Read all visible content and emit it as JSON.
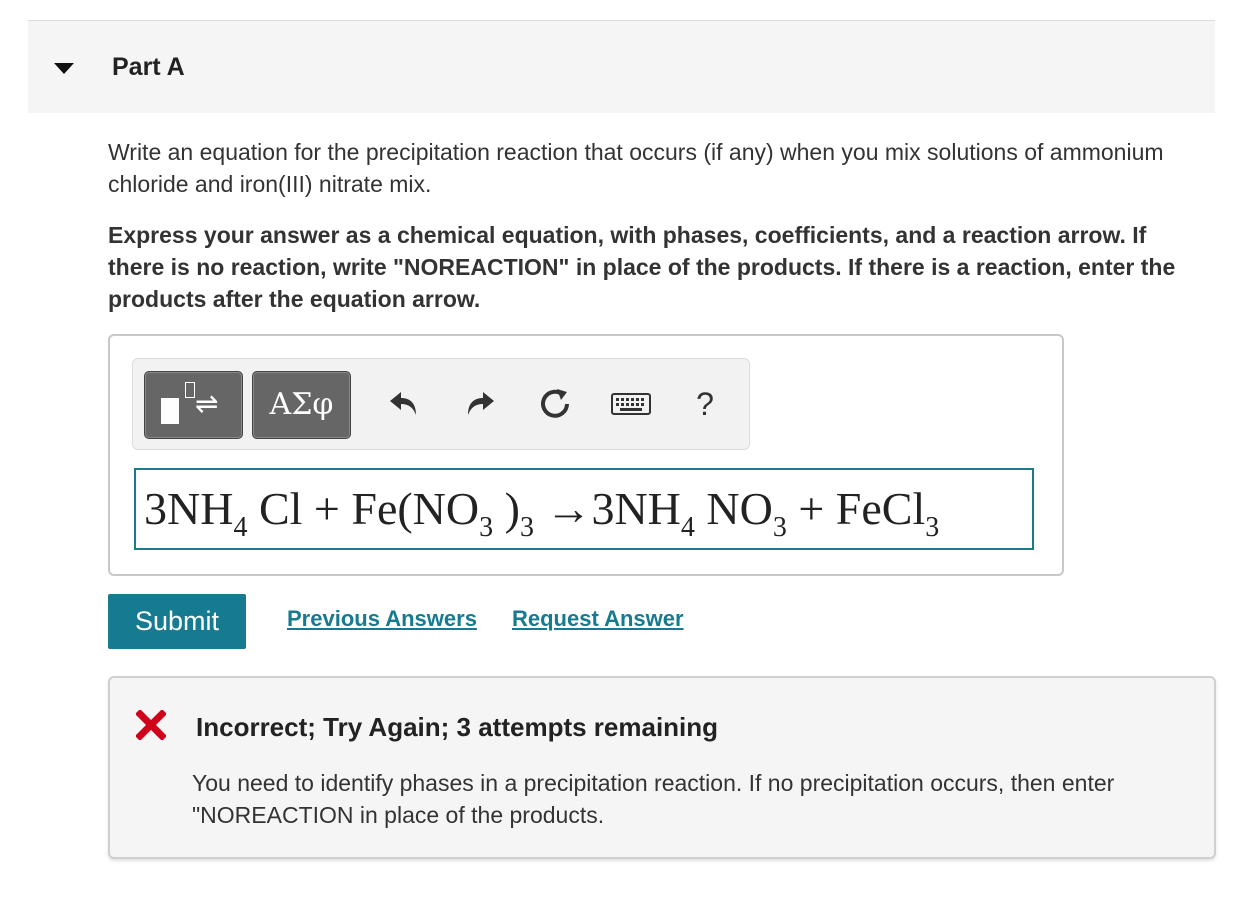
{
  "part": {
    "title": "Part A"
  },
  "question": {
    "text": "Write an equation for the precipitation reaction that occurs (if any) when you mix solutions of ammonium chloride and iron(III) nitrate mix.",
    "instruction": "Express your answer as a chemical equation, with phases, coefficients, and a reaction arrow. If there is no reaction, write \"NOREACTION\" in place of the products. If there is a reaction, enter the products after the equation arrow."
  },
  "toolbar": {
    "templates_arrows": "⇌",
    "symbols_label": "ΑΣφ",
    "help_label": "?",
    "icons": [
      "templates-icon",
      "undo-icon",
      "redo-icon",
      "reset-icon",
      "keyboard-icon"
    ]
  },
  "equation": {
    "t1": "3NH",
    "s1": "4",
    "t2": " Cl + Fe(NO",
    "s2": "3",
    "t3": " )",
    "s3": "3",
    "t4": " →3NH",
    "s4": "4",
    "t5": " NO",
    "s5": "3",
    "t6": "  + FeCl",
    "s6": "3"
  },
  "actions": {
    "submit_label": "Submit",
    "previous_answers_label": "Previous Answers",
    "request_answer_label": "Request Answer"
  },
  "feedback": {
    "title": "Incorrect; Try Again; 3 attempts remaining",
    "message": "You need to identify phases in a precipitation reaction. If no precipitation occurs, then enter \"NOREACTION in place of the products.",
    "icon_color": "#d0021b"
  },
  "colors": {
    "accent": "#167a91",
    "error": "#d0021b"
  }
}
